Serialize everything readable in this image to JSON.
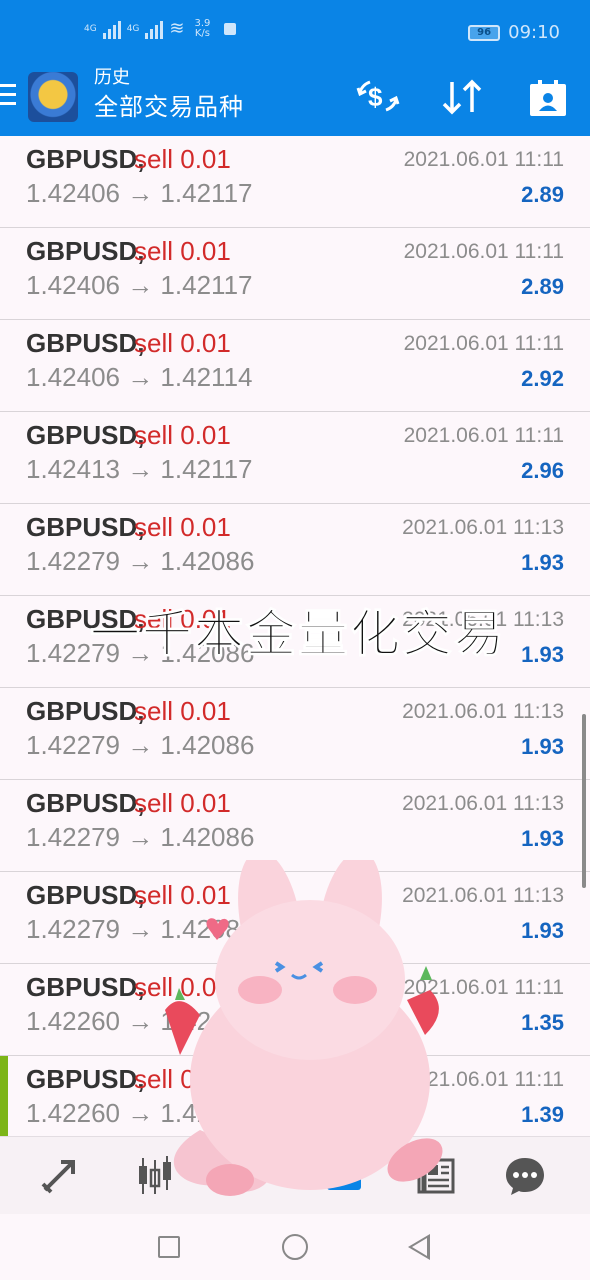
{
  "status_bar": {
    "network_left": "4G",
    "network_right": "4G",
    "speed_value": "3.9",
    "speed_unit": "K/s",
    "battery": "96",
    "time": "09:10"
  },
  "app_bar": {
    "small_title": "历史",
    "main_title": "全部交易品种"
  },
  "trades": [
    {
      "symbol": "GBPUSD,",
      "action": "sell 0.01",
      "prices": "1.42406 → 1.42117",
      "time": "2021.06.01 11:11",
      "profit": "2.89"
    },
    {
      "symbol": "GBPUSD,",
      "action": "sell 0.01",
      "prices": "1.42406 → 1.42117",
      "time": "2021.06.01 11:11",
      "profit": "2.89"
    },
    {
      "symbol": "GBPUSD,",
      "action": "sell 0.01",
      "prices": "1.42406 → 1.42114",
      "time": "2021.06.01 11:11",
      "profit": "2.92"
    },
    {
      "symbol": "GBPUSD,",
      "action": "sell 0.01",
      "prices": "1.42413 → 1.42117",
      "time": "2021.06.01 11:11",
      "profit": "2.96"
    },
    {
      "symbol": "GBPUSD,",
      "action": "sell 0.01",
      "prices": "1.42279 → 1.42086",
      "time": "2021.06.01 11:13",
      "profit": "1.93"
    },
    {
      "symbol": "GBPUSD,",
      "action": "sell 0.01",
      "prices": "1.42279 → 1.42086",
      "time": "2021.06.01 11:13",
      "profit": "1.93"
    },
    {
      "symbol": "GBPUSD,",
      "action": "sell 0.01",
      "prices": "1.42279 → 1.42086",
      "time": "2021.06.01 11:13",
      "profit": "1.93"
    },
    {
      "symbol": "GBPUSD,",
      "action": "sell 0.01",
      "prices": "1.42279 → 1.42086",
      "time": "2021.06.01 11:13",
      "profit": "1.93"
    },
    {
      "symbol": "GBPUSD,",
      "action": "sell 0.01",
      "prices": "1.42279 → 1.42086",
      "time": "2021.06.01 11:13",
      "profit": "1.93"
    },
    {
      "symbol": "GBPUSD,",
      "action": "sell 0.01",
      "prices": "1.42260 → 1.42",
      "time": "2021.06.01 11:11",
      "profit": "1.35"
    },
    {
      "symbol": "GBPUSD,",
      "action": "sell 0.01",
      "prices": "1.42260 → 1.421",
      "time": "2021.06.01 11:11",
      "profit": "1.39"
    }
  ],
  "overlay_caption": "一千本金量化交易",
  "colors": {
    "app_bar": "#0a84e6",
    "sell": "#d22a2a",
    "profit": "#1565c0",
    "marker": "#7cb518"
  },
  "icons": {
    "app_bar": [
      "menu-icon",
      "currency-exchange-icon",
      "sort-icon",
      "calendar-icon"
    ],
    "tabs": [
      "quotes-icon",
      "chart-icon",
      "trade-icon",
      "history-icon",
      "news-icon",
      "chat-icon"
    ],
    "nav": [
      "recents-icon",
      "home-icon",
      "back-icon"
    ]
  }
}
